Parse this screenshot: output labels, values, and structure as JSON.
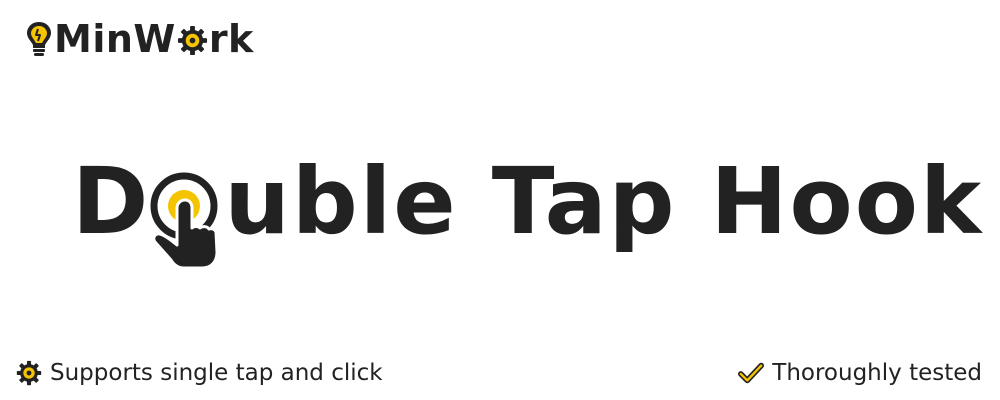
{
  "brand": {
    "logo_text_before": "MinW",
    "logo_text_after": "rk",
    "colors": {
      "accent": "#f5c400",
      "dark": "#222222"
    }
  },
  "hero": {
    "title_start": "D",
    "title_end": "uble Tap Hook",
    "icon": "tap-finger-icon"
  },
  "features": [
    {
      "icon": "gear-icon",
      "label": "Supports single tap and click"
    },
    {
      "icon": "check-icon",
      "label": "Thoroughly tested"
    }
  ]
}
